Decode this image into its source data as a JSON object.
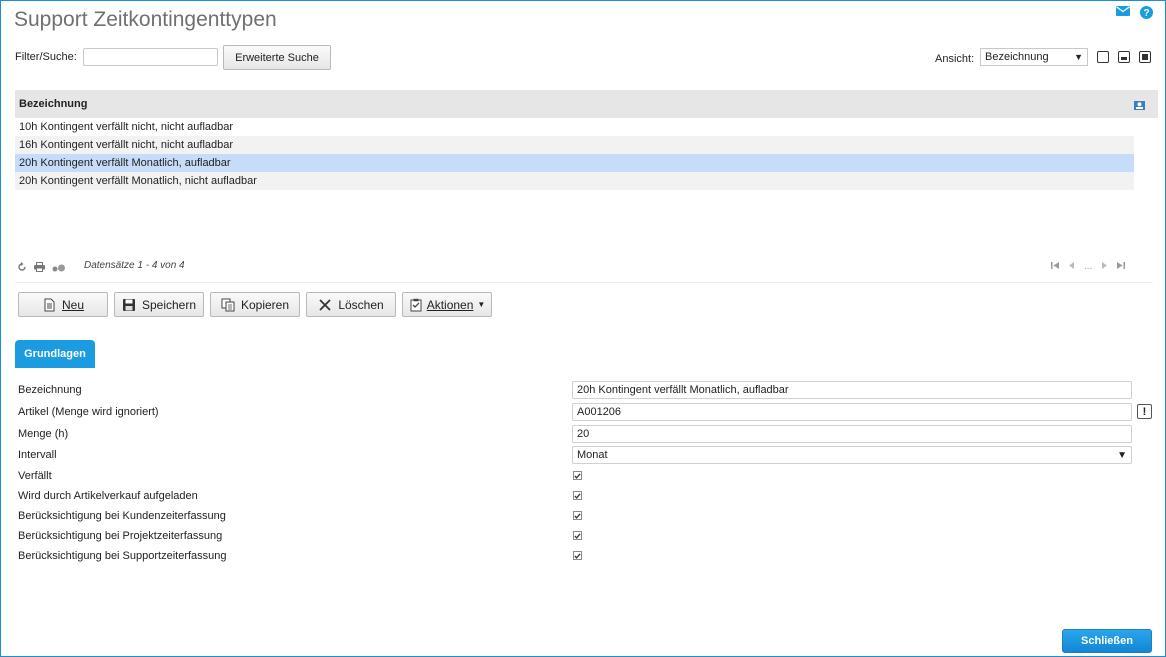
{
  "page": {
    "title": "Support Zeitkontingenttypen"
  },
  "toolbar": {
    "filter_label": "Filter/Suche:",
    "filter_value": "",
    "advanced_search_label": "Erweiterte Suche",
    "view_label": "Ansicht:",
    "view_selected": "Bezeichnung"
  },
  "grid": {
    "column_header": "Bezeichnung",
    "rows": [
      "10h Kontingent verfällt nicht, nicht aufladbar",
      "16h Kontingent verfällt nicht, nicht aufladbar",
      "20h Kontingent verfällt Monatlich, aufladbar",
      "20h Kontingent verfällt Monatlich, nicht aufladbar"
    ],
    "selected_index": 2,
    "records_info": "Datensätze 1 - 4 von 4",
    "pager_ellipsis": "..."
  },
  "actions": {
    "new_label": "Neu",
    "save_label": "Speichern",
    "copy_label": "Kopieren",
    "delete_label": "Löschen",
    "actions_label": "Aktionen"
  },
  "tabs": {
    "basics_label": "Grundlagen"
  },
  "form": {
    "bezeichnung_label": "Bezeichnung",
    "bezeichnung_value": "20h Kontingent verfällt Monatlich, aufladbar",
    "artikel_label": "Artikel (Menge wird ignoriert)",
    "artikel_value": "A001206",
    "artikel_button": "!",
    "menge_label": "Menge (h)",
    "menge_value": "20",
    "intervall_label": "Intervall",
    "intervall_value": "Monat",
    "checkboxes": [
      {
        "label": "Verfällt",
        "checked": true
      },
      {
        "label": "Wird durch Artikelverkauf aufgeladen",
        "checked": true
      },
      {
        "label": "Berücksichtigung bei Kundenzeiterfassung",
        "checked": true
      },
      {
        "label": "Berücksichtigung bei Projektzeiterfassung",
        "checked": true
      },
      {
        "label": "Berücksichtigung bei Supportzeiterfassung",
        "checked": true
      }
    ]
  },
  "footer": {
    "close_label": "Schließen"
  },
  "colors": {
    "accent": "#1c9ce0",
    "selected_row": "#c6dcf8",
    "header_bg": "#e6e6e6"
  },
  "icons": [
    "mail-icon",
    "help-icon",
    "refresh-icon",
    "print-icon",
    "settings-icon",
    "new-doc-icon",
    "save-icon",
    "copy-icon",
    "delete-icon",
    "actions-icon"
  ]
}
